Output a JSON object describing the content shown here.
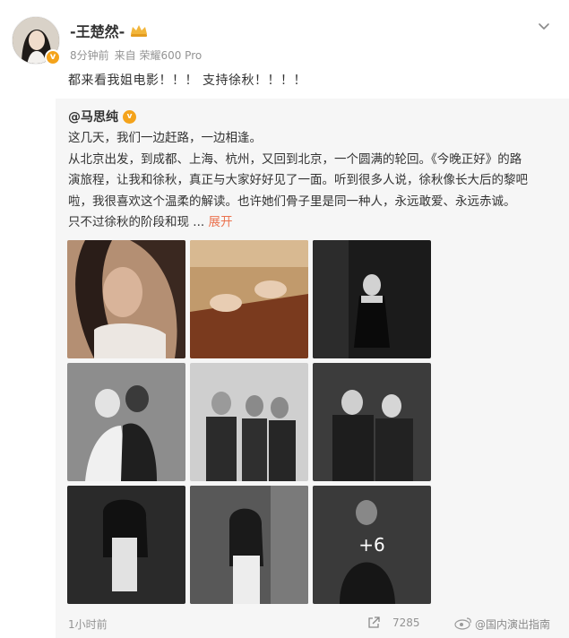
{
  "post": {
    "author_name": "-王楚然-",
    "meta_time": "8分钟前",
    "meta_source": "来自 荣耀600 Pro",
    "text": "都来看我姐电影！！！ 支持徐秋！！！！"
  },
  "repost": {
    "author": "@马思纯",
    "lines": [
      "这几天，我们一边赶路，一边相逢。",
      "从北京出发，到成都、上海、杭州，又回到北京，一个圆满的轮回。《今晚正好》的路",
      "演旅程，让我和徐秋，真正与大家好好见了一面。听到很多人说，徐秋像长大后的黎吧",
      "啦，我很喜欢这个温柔的解读。也许她们骨子里是同一种人，永远敢爱、永远赤诚。"
    ],
    "last_line": "只不过徐秋的阶段和现",
    "ellipsis": " ... ",
    "expand_label": "展开",
    "more_photos": "+6",
    "time": "1小时前",
    "share_count": "7285",
    "watermark": "@国内演出指南"
  },
  "icons": {
    "crown": "crown-icon",
    "verified": "verified-badge-icon",
    "chevron": "chevron-down-icon",
    "share": "share-icon"
  },
  "colors": {
    "verified": "#f4a31b",
    "expand": "#eb7350",
    "meta": "#939393",
    "repost_bg": "#f6f6f6"
  }
}
